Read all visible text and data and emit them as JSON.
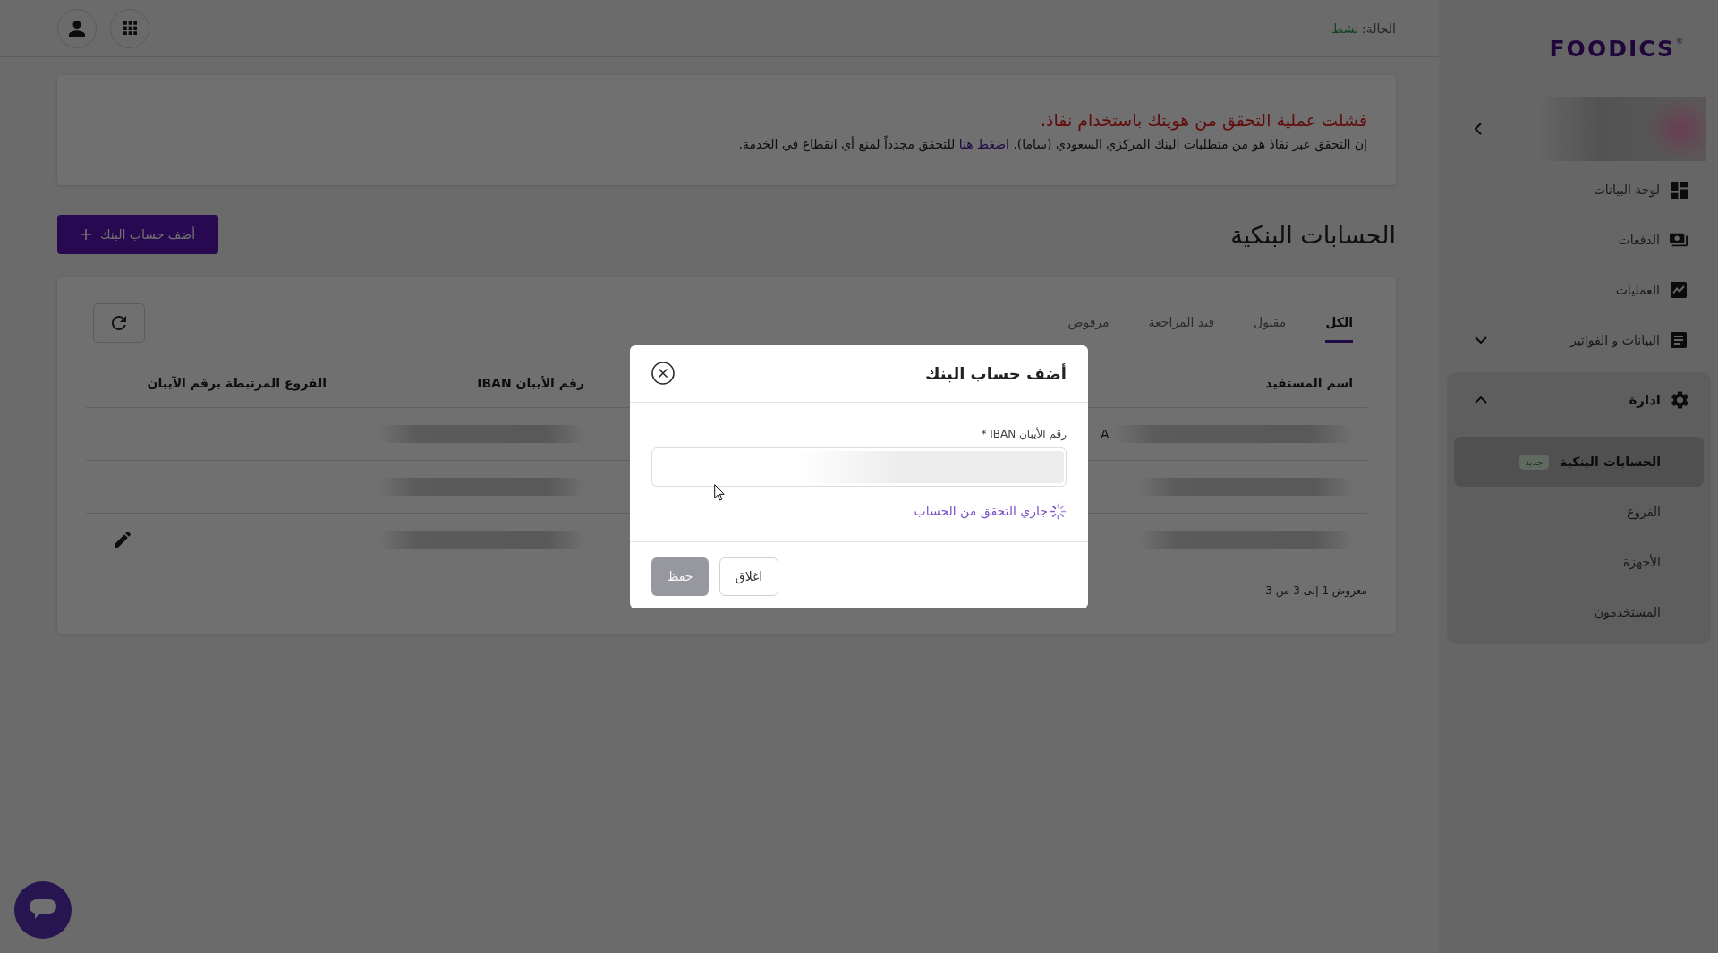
{
  "top_bar": {
    "status_label": "الحالة:",
    "status_value": "نشط"
  },
  "sidebar": {
    "logo": "FOODICS",
    "logo_mark": "®",
    "nav": [
      {
        "kind": "link",
        "label": "لوحة البيانات"
      },
      {
        "kind": "link",
        "label": "الدفعات"
      },
      {
        "kind": "link",
        "label": "العمليات"
      },
      {
        "kind": "group",
        "label": "البيانات و الفواتير",
        "expanded": false
      },
      {
        "kind": "group",
        "label": "ادارة",
        "expanded": true,
        "children": [
          {
            "label": "الحسابات البنكية",
            "selected": true,
            "badge": "جديد"
          },
          {
            "label": "الفروع",
            "selected": false
          },
          {
            "label": "الأجهزة",
            "selected": false
          },
          {
            "label": "المستخدمون",
            "selected": false
          }
        ]
      }
    ]
  },
  "alert": {
    "title": "فشلت عملية التحقق من هويتك باستخدام نفاذ.",
    "text_before": "إن التحقق عبر نفاذ هو من متطلبات البنك المركزي السعودي (ساما).",
    "link": "اضغط هنا",
    "text_after": "للتحقق مجدداً لمنع أي انقطاع في الخدمة."
  },
  "bank_accounts": {
    "title": "الحسابات البنكية",
    "add_button": "أضف حساب البنك",
    "tabs": [
      {
        "label": "الكل",
        "selected": true
      },
      {
        "label": "مقبول",
        "selected": false
      },
      {
        "label": "قيد المراجعة",
        "selected": false
      },
      {
        "label": "مرفوض",
        "selected": false
      }
    ],
    "columns": [
      "اسم المستفيد",
      "رقم الأيبان IBAN",
      "الفروع المرتبطة برقم الآيبان"
    ],
    "rows": [
      {
        "beneficiary": "A",
        "editable": false
      },
      {
        "editable": false
      },
      {
        "editable": true
      }
    ],
    "footer": "معروض 1 إلى 3 من 3"
  },
  "dialog": {
    "title": "أضف حساب البنك",
    "field_label": "رقم الأيبان IBAN *",
    "status_text": "جاري التحقق من الحساب",
    "buttons": [
      {
        "label": "اغلاق",
        "kind": "close",
        "disabled": false
      },
      {
        "label": "حفظ",
        "kind": "save",
        "disabled": true
      }
    ]
  }
}
